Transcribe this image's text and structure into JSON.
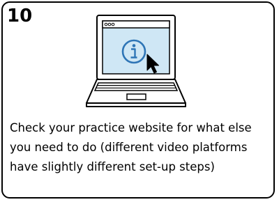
{
  "step": {
    "number": "10"
  },
  "illustration": {
    "icon": "laptop-icon",
    "screen_icon": "info-icon",
    "cursor_icon": "cursor-icon",
    "screen_color": "#cfe7f5",
    "accent_color": "#2e75b6"
  },
  "caption": {
    "text": "Check your practice website for what else you need to do (different video platforms have slightly different set-up steps)"
  }
}
